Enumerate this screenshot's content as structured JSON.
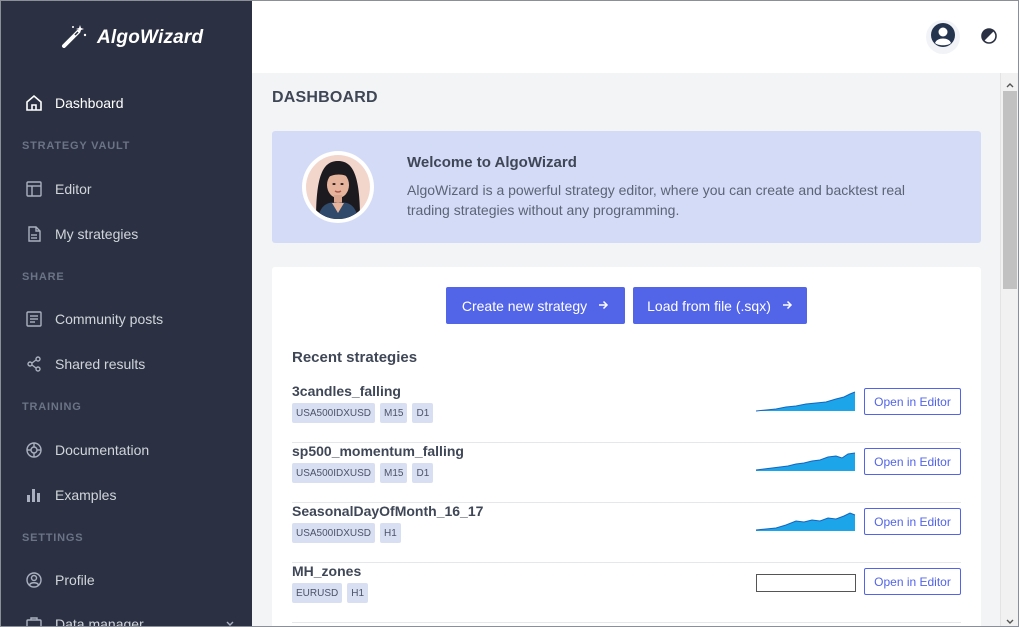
{
  "brand": {
    "name": "AlgoWizard"
  },
  "sidebar": {
    "dashboard": "Dashboard",
    "sections": {
      "strategy_vault": "STRATEGY VAULT",
      "share": "SHARE",
      "training": "TRAINING",
      "settings": "SETTINGS"
    },
    "items": {
      "editor": "Editor",
      "my_strategies": "My strategies",
      "community_posts": "Community posts",
      "shared_results": "Shared results",
      "documentation": "Documentation",
      "examples": "Examples",
      "profile": "Profile",
      "data_manager": "Data manager"
    }
  },
  "page": {
    "title": "DASHBOARD"
  },
  "welcome": {
    "title": "Welcome to AlgoWizard",
    "text": "AlgoWizard is a powerful strategy editor, where you can create and backtest real trading strategies without any programming."
  },
  "actions": {
    "create": "Create new strategy",
    "load": "Load from file (.sqx)"
  },
  "recent": {
    "title": "Recent strategies",
    "open_label": "Open in Editor",
    "items": [
      {
        "name": "3candles_falling",
        "tags": [
          "USA500IDXUSD",
          "M15",
          "D1"
        ],
        "has_chart": true
      },
      {
        "name": "sp500_momentum_falling",
        "tags": [
          "USA500IDXUSD",
          "M15",
          "D1"
        ],
        "has_chart": true
      },
      {
        "name": "SeasonalDayOfMonth_16_17",
        "tags": [
          "USA500IDXUSD",
          "H1"
        ],
        "has_chart": true
      },
      {
        "name": "MH_zones",
        "tags": [
          "EURUSD",
          "H1"
        ],
        "has_chart": false
      }
    ]
  },
  "colors": {
    "sidebar_bg": "#2b3142",
    "accent": "#5264e8",
    "welcome_bg": "#d4dbf6",
    "spark_fill": "#1ca6e9",
    "spark_line": "#1565c0"
  }
}
